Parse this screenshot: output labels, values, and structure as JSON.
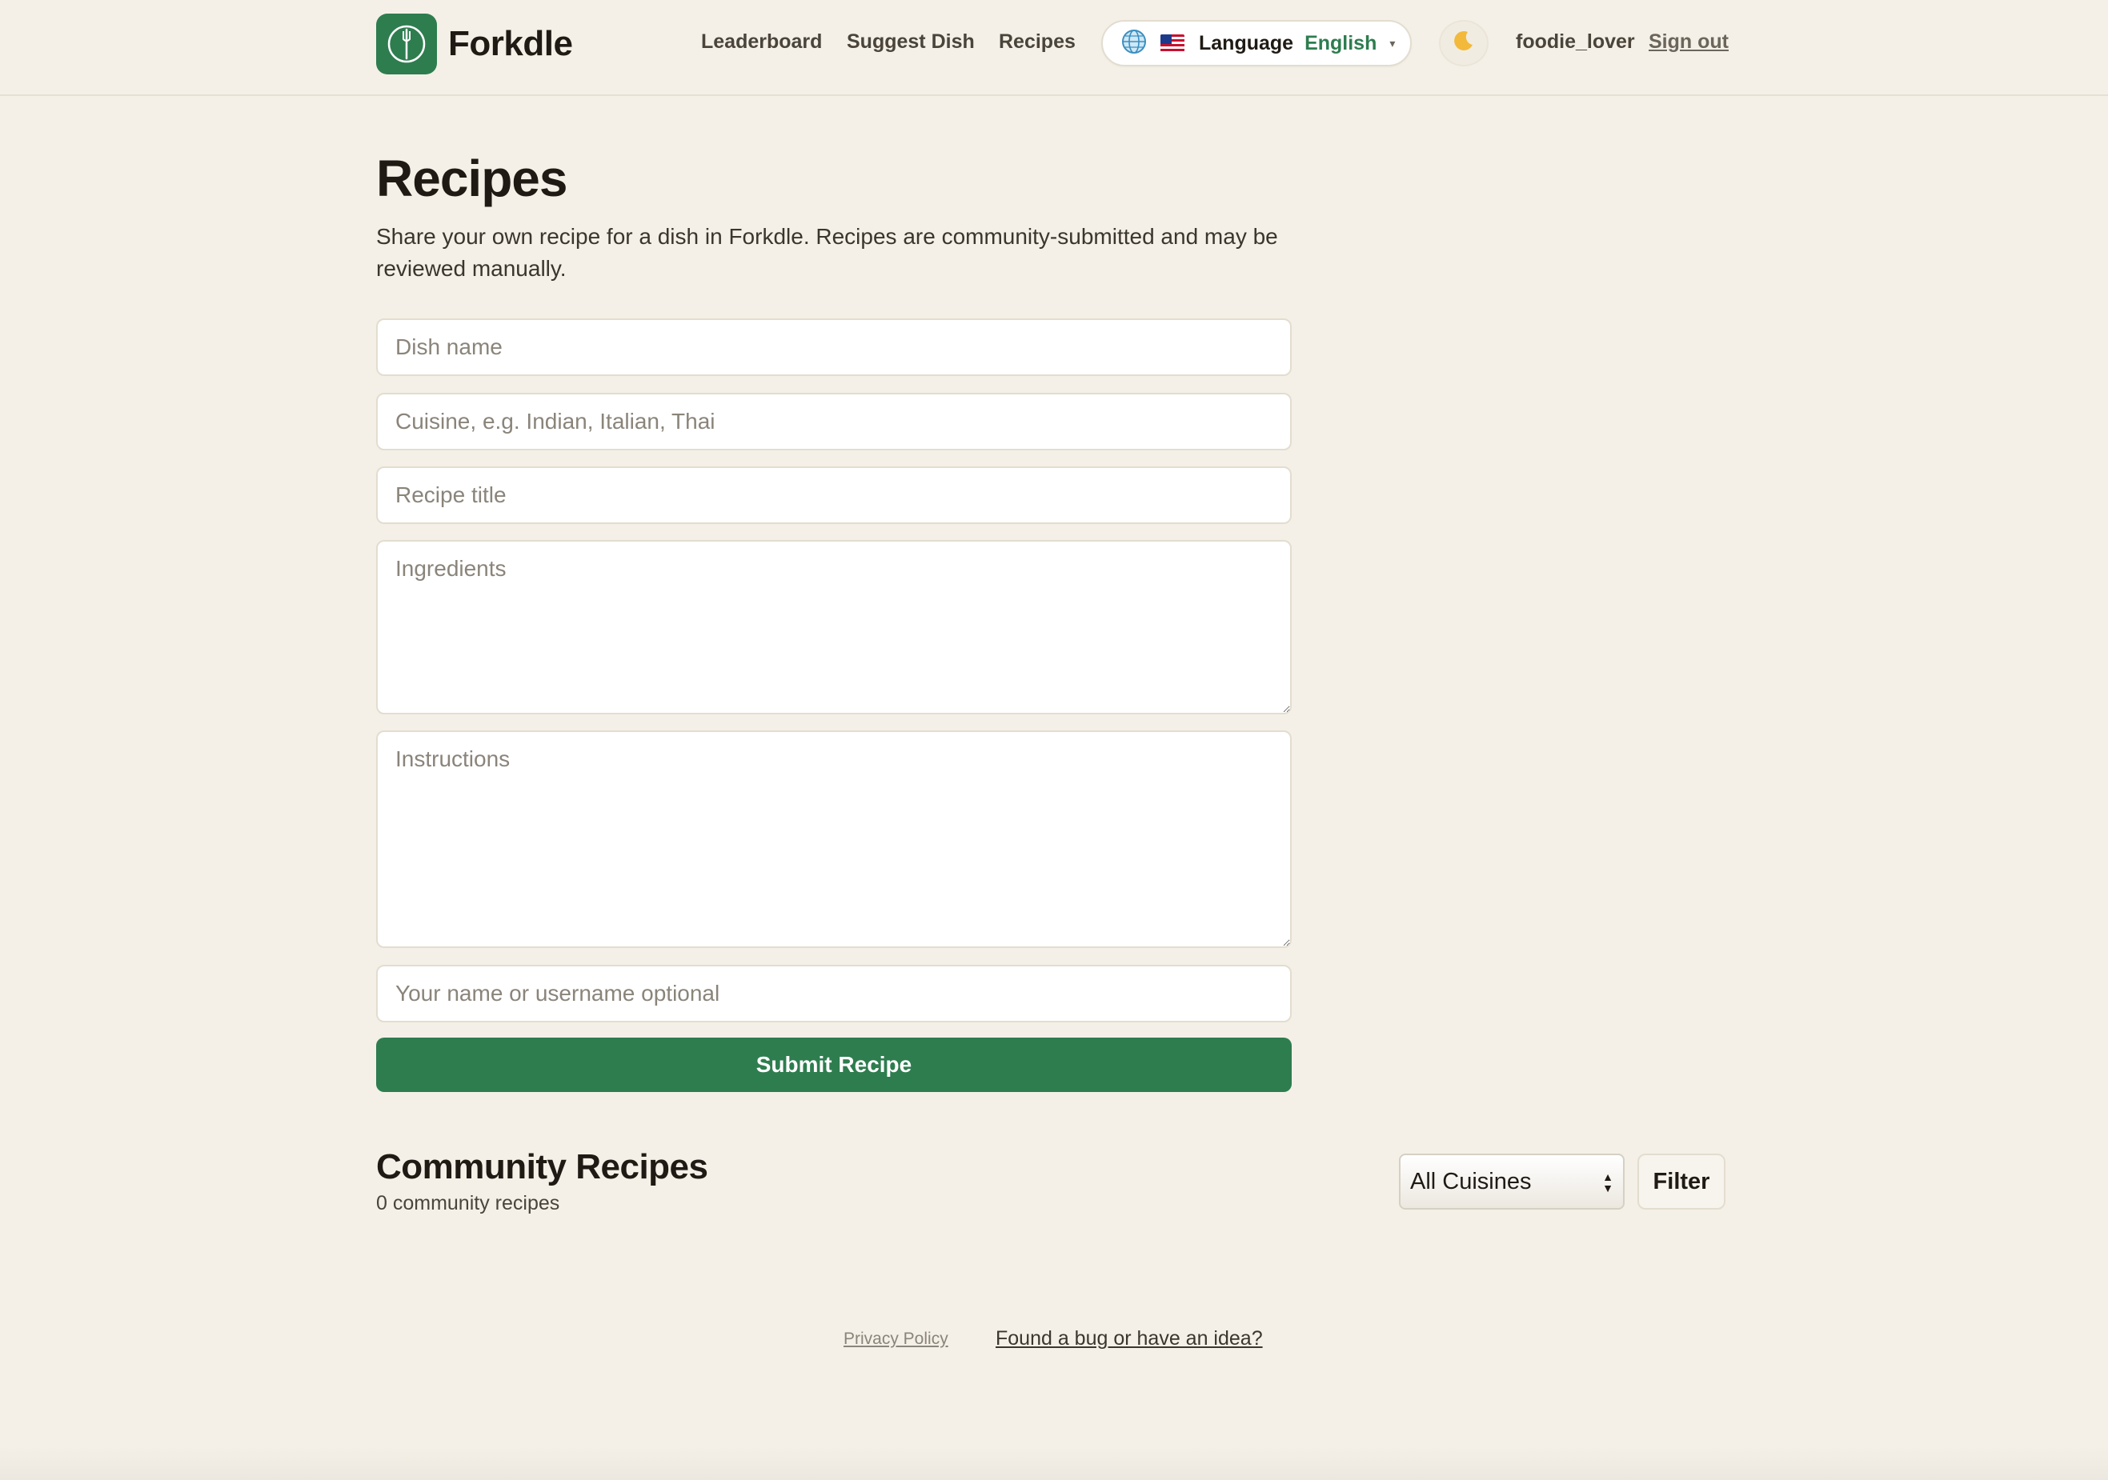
{
  "header": {
    "app_name": "Forkdle",
    "logo_icon": "fork-icon",
    "nav": [
      {
        "label": "Leaderboard"
      },
      {
        "label": "Suggest Dish"
      },
      {
        "label": "Recipes"
      }
    ],
    "language": {
      "globe_icon": "globe-icon",
      "flag_icon": "us-flag-icon",
      "label": "Language",
      "value": "English",
      "caret": "▾"
    },
    "theme_toggle_icon": "moon-icon",
    "username": "foodie_lover",
    "sign_out": "Sign out"
  },
  "main": {
    "title": "Recipes",
    "intro": "Share your own recipe for a dish in Forkdle. Recipes are community-submitted and may be reviewed manually.",
    "form": {
      "dish_name": {
        "value": "",
        "placeholder": "Dish name"
      },
      "cuisine": {
        "value": "",
        "placeholder": "Cuisine, e.g. Indian, Italian, Thai"
      },
      "recipe_title": {
        "value": "",
        "placeholder": "Recipe title"
      },
      "ingredients": {
        "value": "",
        "placeholder": "Ingredients"
      },
      "instructions": {
        "value": "",
        "placeholder": "Instructions"
      },
      "author": {
        "value": "",
        "placeholder": "Your name or username optional"
      },
      "submit_label": "Submit Recipe"
    }
  },
  "community": {
    "title": "Community Recipes",
    "count_text": "0 community recipes",
    "filter_select_value": "All Cuisines",
    "filter_button": "Filter"
  },
  "footer": {
    "privacy": "Privacy Policy",
    "feedback": "Found a bug or have an idea?"
  },
  "colors": {
    "accent": "#2e7d4f",
    "background": "#f4f0e7"
  }
}
